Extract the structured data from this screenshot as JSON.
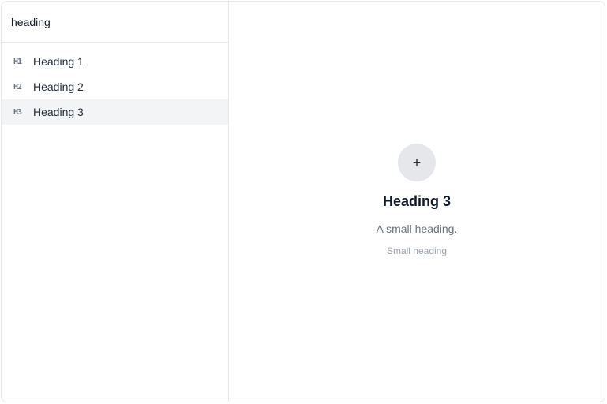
{
  "search": {
    "value": "heading"
  },
  "items": [
    {
      "icon": "H1",
      "icon_name": "heading-1-icon",
      "label": "Heading 1",
      "selected": false
    },
    {
      "icon": "H2",
      "icon_name": "heading-2-icon",
      "label": "Heading 2",
      "selected": false
    },
    {
      "icon": "H3",
      "icon_name": "heading-3-icon",
      "label": "Heading 3",
      "selected": true
    }
  ],
  "preview": {
    "icon": "+",
    "icon_name": "plus-icon",
    "title": "Heading 3",
    "description": "A small heading.",
    "caption": "Small heading"
  },
  "colors": {
    "selected_row": "#f3f4f6",
    "border": "#e5e7eb",
    "muted_text": "#6b7280",
    "caption_text": "#9ca3af"
  }
}
